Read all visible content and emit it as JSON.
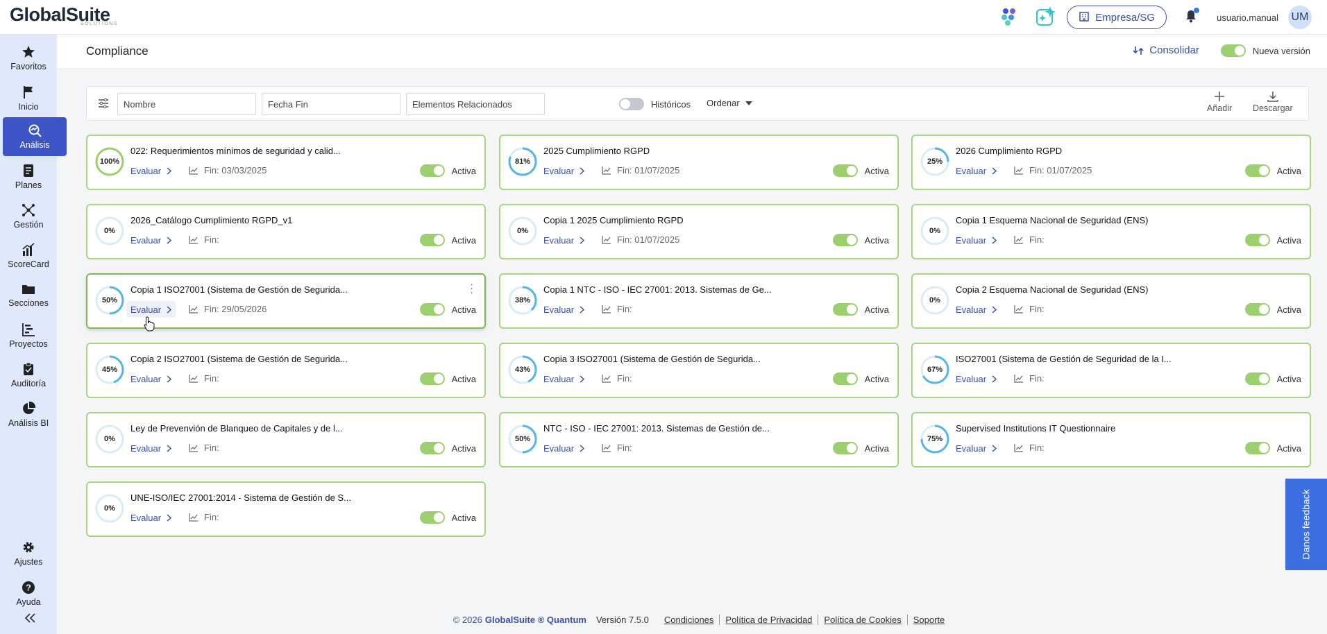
{
  "header": {
    "logo": "GlobalSuite",
    "logo_sub": "SOLUTIONS",
    "company": "Empresa/SG",
    "username": "usuario.manual",
    "avatar_initials": "UM"
  },
  "sidebar": {
    "items": [
      {
        "label": "Favoritos",
        "icon": "star-icon"
      },
      {
        "label": "Inicio",
        "icon": "flag-icon"
      },
      {
        "label": "Análisis",
        "icon": "analysis-icon"
      },
      {
        "label": "Planes",
        "icon": "plans-icon"
      },
      {
        "label": "Gestión",
        "icon": "network-icon"
      },
      {
        "label": "ScoreCard",
        "icon": "bar-chart-icon"
      },
      {
        "label": "Secciones",
        "icon": "folder-icon"
      },
      {
        "label": "Proyectos",
        "icon": "gantt-icon"
      },
      {
        "label": "Auditoría",
        "icon": "clipboard-icon"
      },
      {
        "label": "Análisis BI",
        "icon": "pie-icon"
      },
      {
        "label": "Ajustes",
        "icon": "gear-icon"
      },
      {
        "label": "Ayuda",
        "icon": "help-icon"
      }
    ]
  },
  "page": {
    "title": "Compliance",
    "consolidar": "Consolidar",
    "nueva_version": "Nueva versión"
  },
  "filters": {
    "nombre": "Nombre",
    "fecha_fin": "Fecha Fin",
    "elementos": "Elementos Relacionados",
    "historicos": "Históricos",
    "ordenar": "Ordenar",
    "anadir": "Añadir",
    "descargar": "Descargar"
  },
  "card_labels": {
    "evaluar": "Evaluar",
    "activa": "Activa"
  },
  "cards": [
    {
      "pct": 100,
      "title": "022: Requerimientos mínimos de seguridad y calid...",
      "fin": "Fin: 03/03/2025"
    },
    {
      "pct": 81,
      "title": "2025 Cumplimiento RGPD",
      "fin": "Fin: 01/07/2025"
    },
    {
      "pct": 25,
      "title": "2026 Cumplimiento RGPD",
      "fin": "Fin: 01/07/2025"
    },
    {
      "pct": 0,
      "title": "2026_Catálogo Cumplimiento RGPD_v1",
      "fin": "Fin:"
    },
    {
      "pct": 0,
      "title": "Copia 1 2025 Cumplimiento RGPD",
      "fin": "Fin: 01/07/2025"
    },
    {
      "pct": 0,
      "title": "Copia 1 Esquema Nacional de Seguridad (ENS)",
      "fin": "Fin:"
    },
    {
      "pct": 50,
      "title": "Copia 1 ISO27001 (Sistema de Gestión de Segurida...",
      "fin": "Fin: 29/05/2026"
    },
    {
      "pct": 38,
      "title": "Copia 1 NTC - ISO - IEC 27001: 2013. Sistemas de Ge...",
      "fin": "Fin:"
    },
    {
      "pct": 0,
      "title": "Copia 2 Esquema Nacional de Seguridad (ENS)",
      "fin": "Fin:"
    },
    {
      "pct": 45,
      "title": "Copia 2 ISO27001 (Sistema de Gestión de Segurida...",
      "fin": "Fin:"
    },
    {
      "pct": 43,
      "title": "Copia 3 ISO27001 (Sistema de Gestión de Segurida...",
      "fin": "Fin:"
    },
    {
      "pct": 67,
      "title": "ISO27001 (Sistema de Gestión de Seguridad de la I...",
      "fin": "Fin:"
    },
    {
      "pct": 0,
      "title": "Ley de Prevenvión de Blanqueo de Capitales y de l...",
      "fin": "Fin:"
    },
    {
      "pct": 50,
      "title": "NTC - ISO - IEC 27001: 2013. Sistemas de Gestión de...",
      "fin": "Fin:"
    },
    {
      "pct": 75,
      "title": "Supervised Institutions IT Questionnaire",
      "fin": "Fin:"
    },
    {
      "pct": 0,
      "title": "UNE-ISO/IEC 27001:2014 - Sistema de Gestión de S...",
      "fin": "Fin:"
    }
  ],
  "footer": {
    "copyright": "© 2026",
    "brand": "GlobalSuite ® Quantum",
    "version": "Versión 7.5.0",
    "links": [
      "Condiciones",
      "Política de Privacidad",
      "Política de Cookies",
      "Soporte"
    ]
  },
  "feedback": "Danos feedback",
  "colors": {
    "accent": "#3d54c6",
    "card_border": "#a8d67e",
    "ring": "#56b4e6",
    "toggle_on": "#9ccf6e"
  }
}
